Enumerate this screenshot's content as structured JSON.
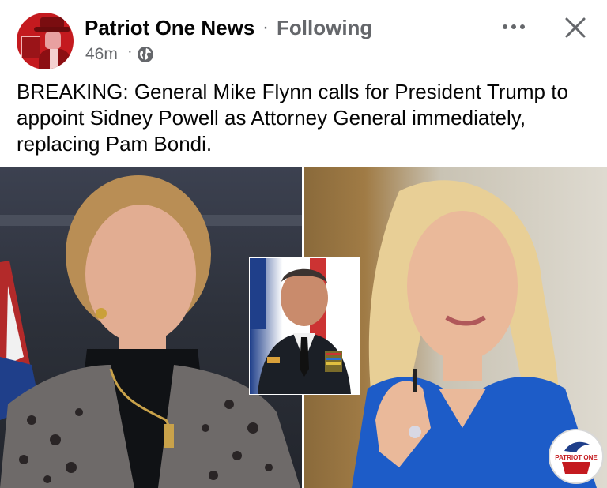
{
  "post": {
    "page_name": "Patriot One News",
    "separator": "·",
    "follow_status": "Following",
    "timestamp": "46m",
    "time_separator": "·",
    "audience_icon": "globe-icon",
    "more_icon": "more-horizontal-icon",
    "close_icon": "close-icon",
    "text": "BREAKING: General Mike Flynn calls for President Trump to appoint Sidney Powell as Attorney General immediately, replacing Pam Bondi."
  },
  "image": {
    "watermark": "PATRIOT ONE"
  },
  "colors": {
    "secondary_text": "#65676b",
    "primary_text": "#050505",
    "brand_red": "#c41a1f"
  }
}
